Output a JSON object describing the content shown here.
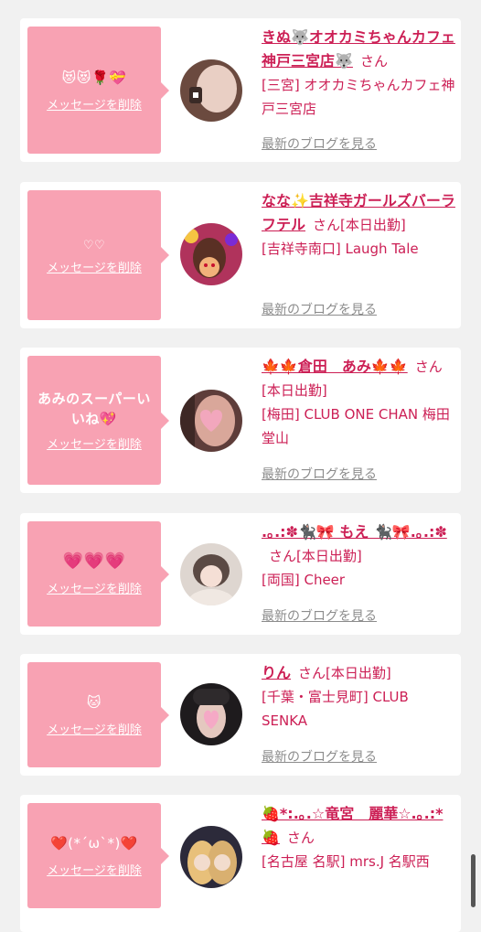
{
  "items": [
    {
      "message": "😻😻🌹💝",
      "delete_label": "メッセージを削除",
      "name": "きぬ🐺オオカミちゃんカフェ神戸三宮店🐺",
      "suffix": "さん",
      "shop": "[三宮] オオカミちゃんカフェ神戸三宮店",
      "blog_label": "最新のブログを見る",
      "avatar_colors": [
        "#6b4a3f",
        "#e9cfc4"
      ]
    },
    {
      "message": "♡♡",
      "delete_label": "メッセージを削除",
      "name": "なな✨吉祥寺ガールズバーラフテル",
      "suffix": "さん[本日出勤]",
      "shop": "[吉祥寺南口] Laugh Tale",
      "blog_label": "最新のブログを見る",
      "avatar_colors": [
        "#b0335c",
        "#f2b27a"
      ]
    },
    {
      "message": "あみのスーパーいいね💖",
      "delete_label": "メッセージを削除",
      "name": "🍁🍁倉田　あみ🍁🍁",
      "suffix": "さん[本日出勤]",
      "shop": "[梅田] CLUB ONE CHAN 梅田堂山",
      "blog_label": "最新のブログを見る",
      "avatar_colors": [
        "#5e3d3a",
        "#f2a7bd"
      ]
    },
    {
      "message": "💗💗💗",
      "delete_label": "メッセージを削除",
      "name": ".｡.:✽🐈‍⬛🎀 もえ 🐈‍⬛🎀.｡.:✽",
      "suffix": "さん[本日出勤]",
      "shop": "[両国] Cheer",
      "blog_label": "最新のブログを見る",
      "avatar_colors": [
        "#b5aba5",
        "#f0e8e2"
      ]
    },
    {
      "message": "🐱",
      "delete_label": "メッセージを削除",
      "name": "りん",
      "suffix": "さん[本日出勤]",
      "shop": "[千葉・富士見町] CLUB SENKA",
      "blog_label": "最新のブログを見る",
      "avatar_colors": [
        "#1e1b1d",
        "#f5a9c6"
      ]
    },
    {
      "message": "❤️(*´ω`*)❤️",
      "delete_label": "メッセージを削除",
      "name": "🍓*:.｡.☆竜宮　麗華☆.｡.:*🍓",
      "suffix": "さん",
      "shop": "[名古屋 名駅] mrs.J 名駅西",
      "blog_label": "",
      "avatar_colors": [
        "#2c2a3a",
        "#e8c07a"
      ]
    }
  ]
}
